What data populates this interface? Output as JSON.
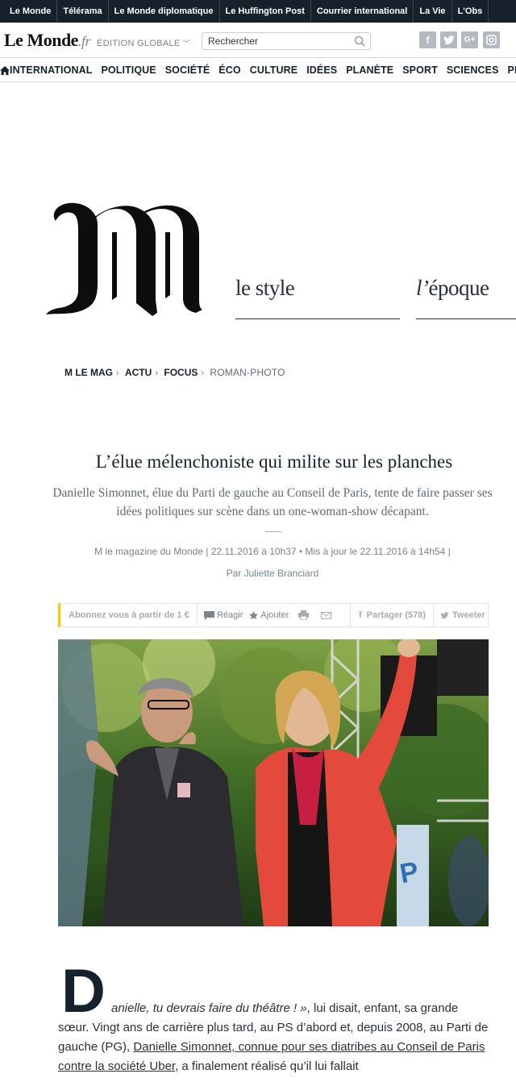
{
  "topbar": {
    "links": [
      "Le Monde",
      "Télérama",
      "Le Monde diplomatique",
      "Le Huffington Post",
      "Courrier international",
      "La Vie",
      "L'Obs"
    ]
  },
  "header": {
    "logo_main": "Le Monde",
    "logo_suffix": ".fr",
    "edition": "ÉDITION GLOBALE",
    "search_placeholder": "Rechercher",
    "social": [
      "f",
      "t",
      "G+",
      "ig"
    ]
  },
  "nav": {
    "items": [
      "INTERNATIONAL",
      "POLITIQUE",
      "SOCIÉTÉ",
      "ÉCO",
      "CULTURE",
      "IDÉES",
      "PLANÈTE",
      "SPORT",
      "SCIENCES",
      "PIXELS"
    ]
  },
  "m": {
    "style_label": "le style",
    "epoque_prefix": "l’",
    "epoque_rest": "époque"
  },
  "breadcrumb": {
    "items": [
      "M LE MAG",
      "ACTU",
      "FOCUS"
    ],
    "current": "ROMAN-PHOTO"
  },
  "article": {
    "title": "L’élue mélenchoniste qui milite sur les planches",
    "description": "Danielle Simonnet, élue du Parti de gauche au Conseil de Paris, tente de faire passer ses idées politiques sur scène dans un one-woman-show décapant.",
    "meta": "M le magazine du Monde | 22.11.2016 à 10h37 • Mis à jour le 22.11.2016 à 14h54 |",
    "byline": "Par Juliette Branciard"
  },
  "actions": {
    "subscribe": "Abonnez vous à partir de 1 €",
    "react": "Réagir",
    "add": "Ajouter",
    "share": "Partager (578)",
    "tweet": "Tweeter"
  },
  "body": {
    "dropcap": "D",
    "line1": "anielle, tu devrais faire du théâtre ! »",
    "line1b": ", lui disait, enfant, sa grande",
    "text2": "sœur. Vingt ans de carrière plus tard, au PS d’abord et, depuis 2008, au Parti de gauche (PG), ",
    "link": "Danielle Simonnet, connue pour ses diatribes au Conseil de Paris contre la société Uber",
    "text3": ", a finalement réalisé qu’il lui fallait"
  },
  "colors": {
    "topbar_bg": "#16212c",
    "accent_yellow": "#ffc700",
    "text_dark": "#16212c",
    "text_grey": "#7a8590"
  }
}
